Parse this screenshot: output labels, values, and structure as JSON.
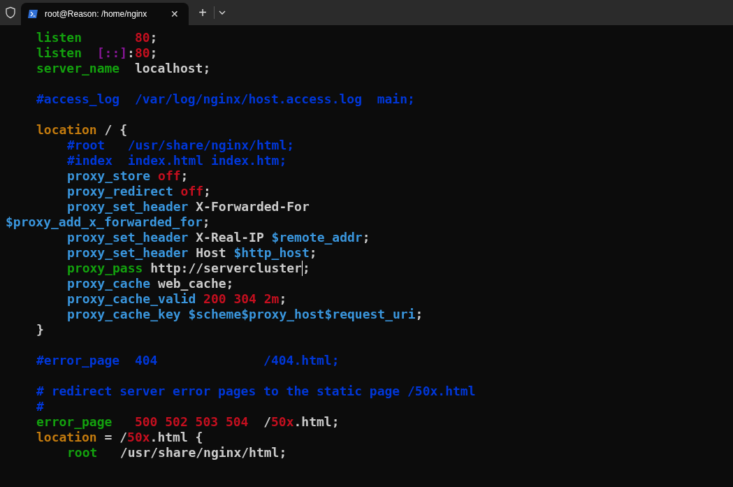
{
  "tab_bar": {
    "tabs": [
      {
        "title": "root@Reason: /home/nginx",
        "selected": true,
        "close": "✕"
      }
    ],
    "new_tab": "+"
  },
  "terminal": {
    "lines": [
      {
        "kind": "block",
        "segments": [
          {
            "t": "listen       ",
            "kind": "directive"
          },
          {
            "t": "80",
            "kind": "number"
          },
          {
            "t": ";",
            "kind": "plain"
          }
        ]
      },
      {
        "kind": "block",
        "segments": [
          {
            "t": "listen  ",
            "kind": "directive"
          },
          {
            "t": "[::]",
            "kind": "bracket"
          },
          {
            "t": ":",
            "kind": "plain"
          },
          {
            "t": "80",
            "kind": "number"
          },
          {
            "t": ";",
            "kind": "plain"
          }
        ]
      },
      {
        "kind": "block",
        "segments": [
          {
            "t": "server_name  ",
            "kind": "directive"
          },
          {
            "t": "localhost;",
            "kind": "plain"
          }
        ]
      },
      {
        "kind": "blank"
      },
      {
        "kind": "block",
        "segments": [
          {
            "t": "#access_log  /var/log/nginx/host.access.log  main;",
            "kind": "comment"
          }
        ]
      },
      {
        "kind": "blank"
      },
      {
        "kind": "block",
        "segments": [
          {
            "t": "location",
            "kind": "keyword"
          },
          {
            "t": " / {",
            "kind": "plain"
          }
        ]
      },
      {
        "kind": "nested",
        "segments": [
          {
            "t": "#root   /usr/share/nginx/html;",
            "kind": "comment"
          }
        ]
      },
      {
        "kind": "nested",
        "segments": [
          {
            "t": "#index  index.html index.htm;",
            "kind": "comment"
          }
        ]
      },
      {
        "kind": "nested",
        "segments": [
          {
            "t": "proxy_store ",
            "kind": "proxy"
          },
          {
            "t": "off",
            "kind": "number"
          },
          {
            "t": ";",
            "kind": "plain"
          }
        ]
      },
      {
        "kind": "nested",
        "segments": [
          {
            "t": "proxy_redirect ",
            "kind": "proxy"
          },
          {
            "t": "off",
            "kind": "number"
          },
          {
            "t": ";",
            "kind": "plain"
          }
        ]
      },
      {
        "kind": "nested",
        "segments": [
          {
            "t": "proxy_set_header ",
            "kind": "proxy"
          },
          {
            "t": "X-Forwarded-For",
            "kind": "plain"
          }
        ]
      },
      {
        "kind": "wrapped",
        "segments": [
          {
            "t": "$proxy_add_x_forwarded_for",
            "kind": "variable"
          },
          {
            "t": ";",
            "kind": "plain"
          }
        ]
      },
      {
        "kind": "nested",
        "segments": [
          {
            "t": "proxy_set_header ",
            "kind": "proxy"
          },
          {
            "t": "X-Real-IP ",
            "kind": "plain"
          },
          {
            "t": "$remote_addr",
            "kind": "variable"
          },
          {
            "t": ";",
            "kind": "plain"
          }
        ]
      },
      {
        "kind": "nested",
        "segments": [
          {
            "t": "proxy_set_header ",
            "kind": "proxy"
          },
          {
            "t": "Host ",
            "kind": "plain"
          },
          {
            "t": "$http_host",
            "kind": "variable"
          },
          {
            "t": ";",
            "kind": "plain"
          }
        ]
      },
      {
        "kind": "nested",
        "segments": [
          {
            "t": "proxy_pass ",
            "kind": "directive"
          },
          {
            "t": "http://servercluster",
            "kind": "plain",
            "cursor": true
          },
          {
            "t": ";",
            "kind": "plain"
          }
        ]
      },
      {
        "kind": "nested",
        "segments": [
          {
            "t": "proxy_cache ",
            "kind": "proxy"
          },
          {
            "t": "web_cache;",
            "kind": "plain"
          }
        ]
      },
      {
        "kind": "nested",
        "segments": [
          {
            "t": "proxy_cache_valid ",
            "kind": "proxy"
          },
          {
            "t": "200 304 2m",
            "kind": "number"
          },
          {
            "t": ";",
            "kind": "plain"
          }
        ]
      },
      {
        "kind": "nested",
        "segments": [
          {
            "t": "proxy_cache_key ",
            "kind": "proxy"
          },
          {
            "t": "$scheme$proxy_host$request_uri",
            "kind": "variable"
          },
          {
            "t": ";",
            "kind": "plain"
          }
        ]
      },
      {
        "kind": "block",
        "segments": [
          {
            "t": "}",
            "kind": "plain"
          }
        ]
      },
      {
        "kind": "blank"
      },
      {
        "kind": "block",
        "segments": [
          {
            "t": "#error_page  404              /404.html;",
            "kind": "comment"
          }
        ]
      },
      {
        "kind": "blank"
      },
      {
        "kind": "block",
        "segments": [
          {
            "t": "# redirect server error pages to the static page /50x.html",
            "kind": "comment"
          }
        ]
      },
      {
        "kind": "block",
        "segments": [
          {
            "t": "#",
            "kind": "comment"
          }
        ]
      },
      {
        "kind": "block",
        "segments": [
          {
            "t": "error_page   ",
            "kind": "directive"
          },
          {
            "t": "500 502 503 504",
            "kind": "number"
          },
          {
            "t": "  /",
            "kind": "plain"
          },
          {
            "t": "50x",
            "kind": "number"
          },
          {
            "t": ".html;",
            "kind": "plain"
          }
        ]
      },
      {
        "kind": "block",
        "segments": [
          {
            "t": "location",
            "kind": "keyword"
          },
          {
            "t": " = /",
            "kind": "plain"
          },
          {
            "t": "50x",
            "kind": "number"
          },
          {
            "t": ".html {",
            "kind": "plain"
          }
        ]
      },
      {
        "kind": "nested",
        "segments": [
          {
            "t": "root   ",
            "kind": "directive"
          },
          {
            "t": "/usr/share/nginx/html;",
            "kind": "plain"
          }
        ]
      }
    ]
  }
}
